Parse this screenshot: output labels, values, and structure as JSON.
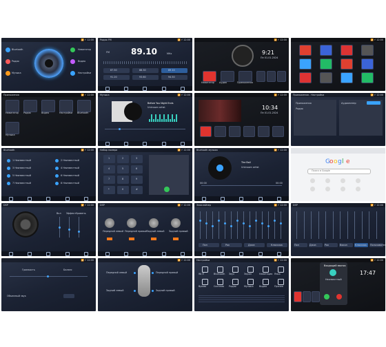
{
  "colors": {
    "accent": "#3aa3ff",
    "orange": "#ff7a1a",
    "red": "#e0342f",
    "bg": "#1b2233"
  },
  "cells": {
    "c01": {
      "side_labels": [
        "Bluetooth",
        "Радио",
        "Музыка",
        "Навигатор",
        "Видео",
        "Настройки"
      ]
    },
    "c02": {
      "title": "Радио FM",
      "freq": "89.10",
      "unit": "MHz",
      "band": "FM",
      "presets": [
        "87.50",
        "88.30",
        "89.10",
        "91.20",
        "93.60",
        "94.50"
      ]
    },
    "c03": {
      "time": "9:21",
      "date": "Пн 01.01.2024",
      "apps": [
        "Навигатор",
        "Аудио",
        "Приложения"
      ]
    },
    "c04": {
      "icons": [
        "chrome-icon",
        "gallery-icon",
        "video-icon",
        "settings-icon",
        "bluetooth-icon",
        "music-icon"
      ]
    },
    "c05": {
      "title": "Приложения",
      "apps": [
        "Навигатор",
        "Радио",
        "Видео",
        "Настройки",
        "Bluetooth",
        "Музыка"
      ]
    },
    "c06": {
      "title": "Музыка",
      "song": "Before You Night Ends",
      "artist": "Unknown artist"
    },
    "c07": {
      "time": "10:34",
      "date": "Пн 01.01.2024"
    },
    "c08": {
      "title": "Приложения - Настройки",
      "panel_left": "Приложения",
      "panel_right": "Аудиоплеер",
      "item": "Радио"
    },
    "c09": {
      "title": "Bluetooth",
      "contacts": [
        "1 Неизвестный",
        "2 Неизвестный",
        "3 Неизвестный",
        "4 Неизвестный",
        "5 Неизвестный",
        "6 Неизвестный",
        "7 Неизвестный",
        "8 Неизвестный"
      ]
    },
    "c10": {
      "title": "Набор номера",
      "keys": [
        "1",
        "2",
        "3",
        "4",
        "5",
        "6",
        "7",
        "8",
        "9",
        "*",
        "0",
        "#"
      ]
    },
    "c11": {
      "title": "Bluetooth музыка",
      "song": "The Ball",
      "artist": "Unknown artist",
      "time_start": "00:00",
      "time_end": "00:00"
    },
    "c12": {
      "search": "Поиск в Google",
      "logo_letters": [
        "G",
        "o",
        "o",
        "g",
        "l",
        "e"
      ]
    },
    "c13": {
      "title": "DSP",
      "labels": [
        "Вкл",
        "Эффект",
        "Уровень"
      ]
    },
    "c14": {
      "title": "DSP",
      "labels": [
        "Передний левый",
        "Передний правый",
        "Задний левый",
        "Задний правый"
      ]
    },
    "c15": {
      "title": "Эквалайзер",
      "presets": [
        "Поп",
        "Рок",
        "Джаз",
        "Классика"
      ]
    },
    "c16": {
      "title": "DSP",
      "modes": [
        "Поп",
        "Джаз",
        "Рок",
        "Вокал",
        "Классика",
        "Пользователь"
      ]
    },
    "c17": {
      "left_label": "Громкость",
      "right_label": "Баланс",
      "bottom_label": "Объемный звук"
    },
    "c18": {
      "labels": [
        "Передний левый",
        "Передний правый",
        "Задний левый",
        "Задний правый"
      ]
    },
    "c19": {
      "title": "Настройки",
      "items": [
        "Wi-Fi",
        "Bluetooth",
        "Звук",
        "Экран",
        "Навигация",
        "Язык",
        "Время",
        "Система",
        "Радио",
        "Музыка",
        "Видео",
        "Прочее"
      ]
    },
    "c20": {
      "time": "17:47",
      "call_title": "Входящий звонок",
      "caller": "Неизвестный"
    }
  }
}
